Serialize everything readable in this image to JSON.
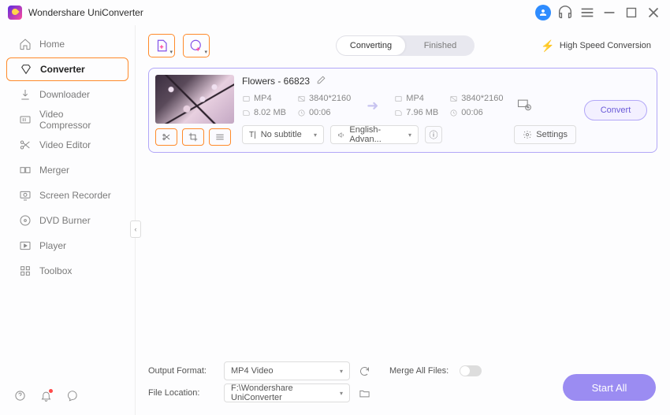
{
  "appTitle": "Wondershare UniConverter",
  "sidebar": {
    "items": [
      {
        "label": "Home"
      },
      {
        "label": "Converter"
      },
      {
        "label": "Downloader"
      },
      {
        "label": "Video Compressor"
      },
      {
        "label": "Video Editor"
      },
      {
        "label": "Merger"
      },
      {
        "label": "Screen Recorder"
      },
      {
        "label": "DVD Burner"
      },
      {
        "label": "Player"
      },
      {
        "label": "Toolbox"
      }
    ]
  },
  "tabs": {
    "converting": "Converting",
    "finished": "Finished"
  },
  "highSpeed": "High Speed Conversion",
  "file": {
    "title": "Flowers - 66823",
    "src": {
      "format": "MP4",
      "resolution": "3840*2160",
      "size": "8.02 MB",
      "duration": "00:06"
    },
    "dst": {
      "format": "MP4",
      "resolution": "3840*2160",
      "size": "7.96 MB",
      "duration": "00:06"
    },
    "subtitle": "No subtitle",
    "audio": "English-Advan...",
    "settingsLabel": "Settings",
    "convertLabel": "Convert"
  },
  "bottom": {
    "outputFormatLabel": "Output Format:",
    "outputFormatValue": "MP4 Video",
    "fileLocationLabel": "File Location:",
    "fileLocationValue": "F:\\Wondershare UniConverter",
    "mergeLabel": "Merge All Files:",
    "startAll": "Start All"
  }
}
